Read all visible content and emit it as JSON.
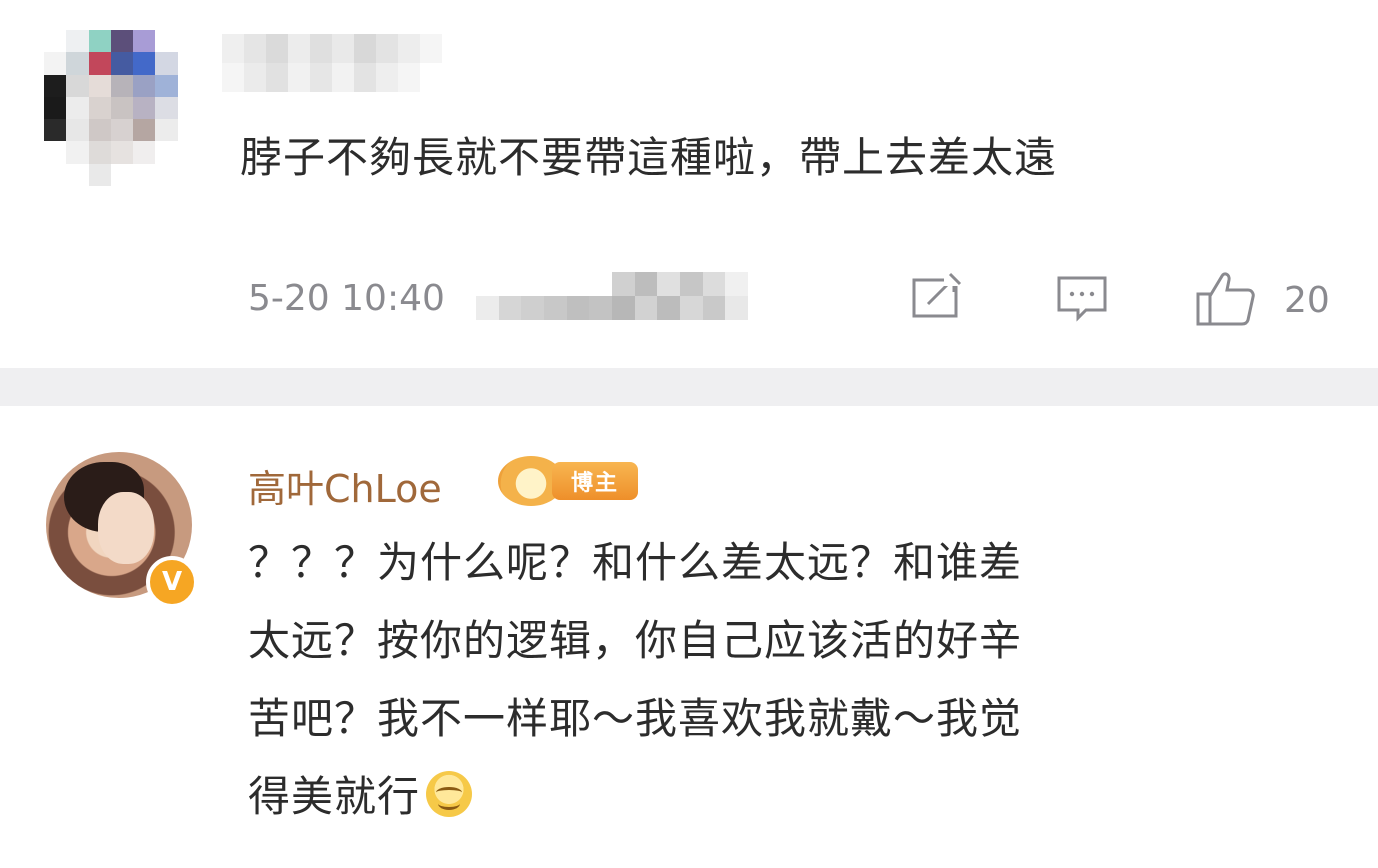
{
  "comment1": {
    "text": "脖子不夠長就不要帶這種啦，帶上去差太遠",
    "time": "5-20 10:40",
    "actions": {
      "repost_icon": "repost-icon",
      "comment_icon": "comment-icon",
      "like_icon": "thumbs-up-icon",
      "like_count": "20"
    }
  },
  "comment2": {
    "author": "高叶ChLoe",
    "author_badge": "博主",
    "verified_mark": "V",
    "lines": [
      "？？？为什么呢？和什么差太远？和谁差",
      "太远？按你的逻辑，你自己应该活的好辛",
      "苦吧？我不一样耶～我喜欢我就戴～我觉",
      "得美就行"
    ],
    "emoji": "smile-emoji"
  },
  "colors": {
    "author_name": "#a0683a",
    "badge": "#f6a623",
    "divider": "#efeff1",
    "meta_text": "#8a8a8f"
  }
}
